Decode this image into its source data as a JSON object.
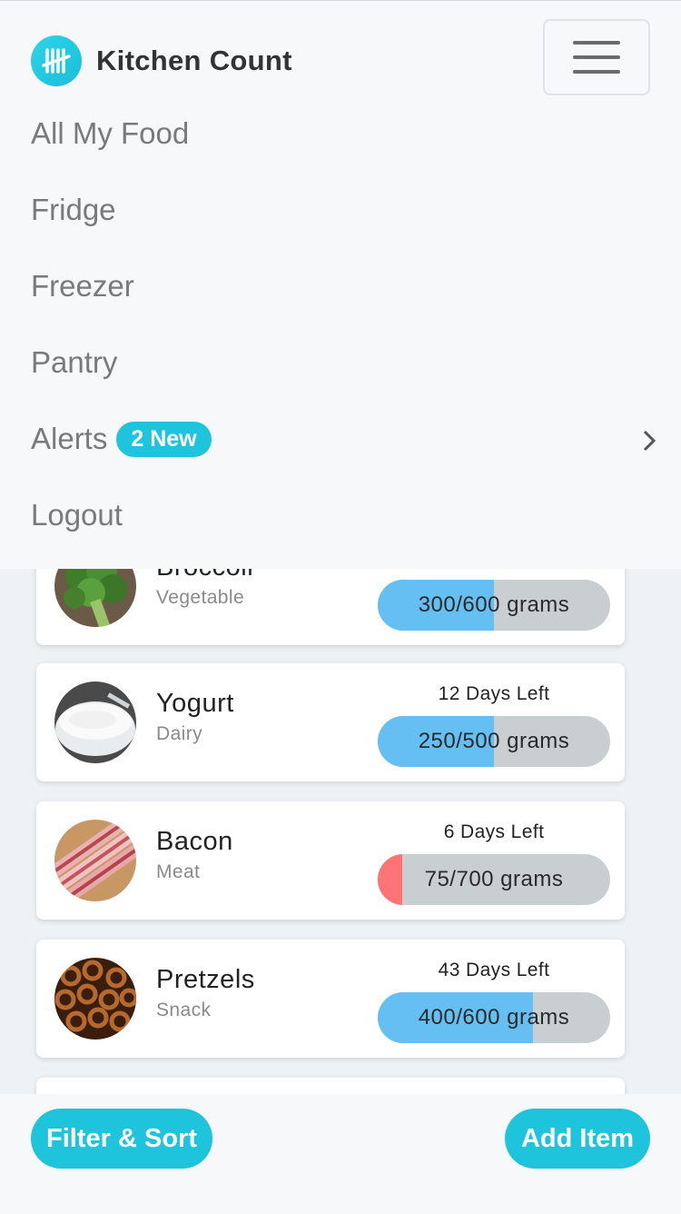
{
  "app": {
    "name": "Kitchen Count",
    "accent": "#1ec3dc"
  },
  "header": {
    "logo_icon": "tally-marks-icon",
    "menu_icon": "hamburger-icon"
  },
  "nav": {
    "items": [
      {
        "label": "All My Food"
      },
      {
        "label": "Fridge"
      },
      {
        "label": "Freezer"
      },
      {
        "label": "Pantry"
      },
      {
        "label": "Alerts",
        "badge": "2 New",
        "icon": "chevron-right-icon"
      },
      {
        "label": "Logout"
      }
    ]
  },
  "foods": [
    {
      "name": "Broccoli",
      "category": "Vegetable",
      "days_left": "",
      "quantity_text": "300/600 grams",
      "fraction": 0.5,
      "bar_color": "#65bff2",
      "image_icon": "broccoli-image"
    },
    {
      "name": "Yogurt",
      "category": "Dairy",
      "days_left": "12 Days Left",
      "quantity_text": "250/500 grams",
      "fraction": 0.5,
      "bar_color": "#65bff2",
      "image_icon": "yogurt-image"
    },
    {
      "name": "Bacon",
      "category": "Meat",
      "days_left": "6 Days Left",
      "quantity_text": "75/700 grams",
      "fraction": 0.107,
      "bar_color": "#fe7474",
      "image_icon": "bacon-image"
    },
    {
      "name": "Pretzels",
      "category": "Snack",
      "days_left": "43 Days Left",
      "quantity_text": "400/600 grams",
      "fraction": 0.667,
      "bar_color": "#65bff2",
      "image_icon": "pretzels-image"
    }
  ],
  "bottom_bar": {
    "filter_label": "Filter & Sort",
    "add_label": "Add Item"
  }
}
